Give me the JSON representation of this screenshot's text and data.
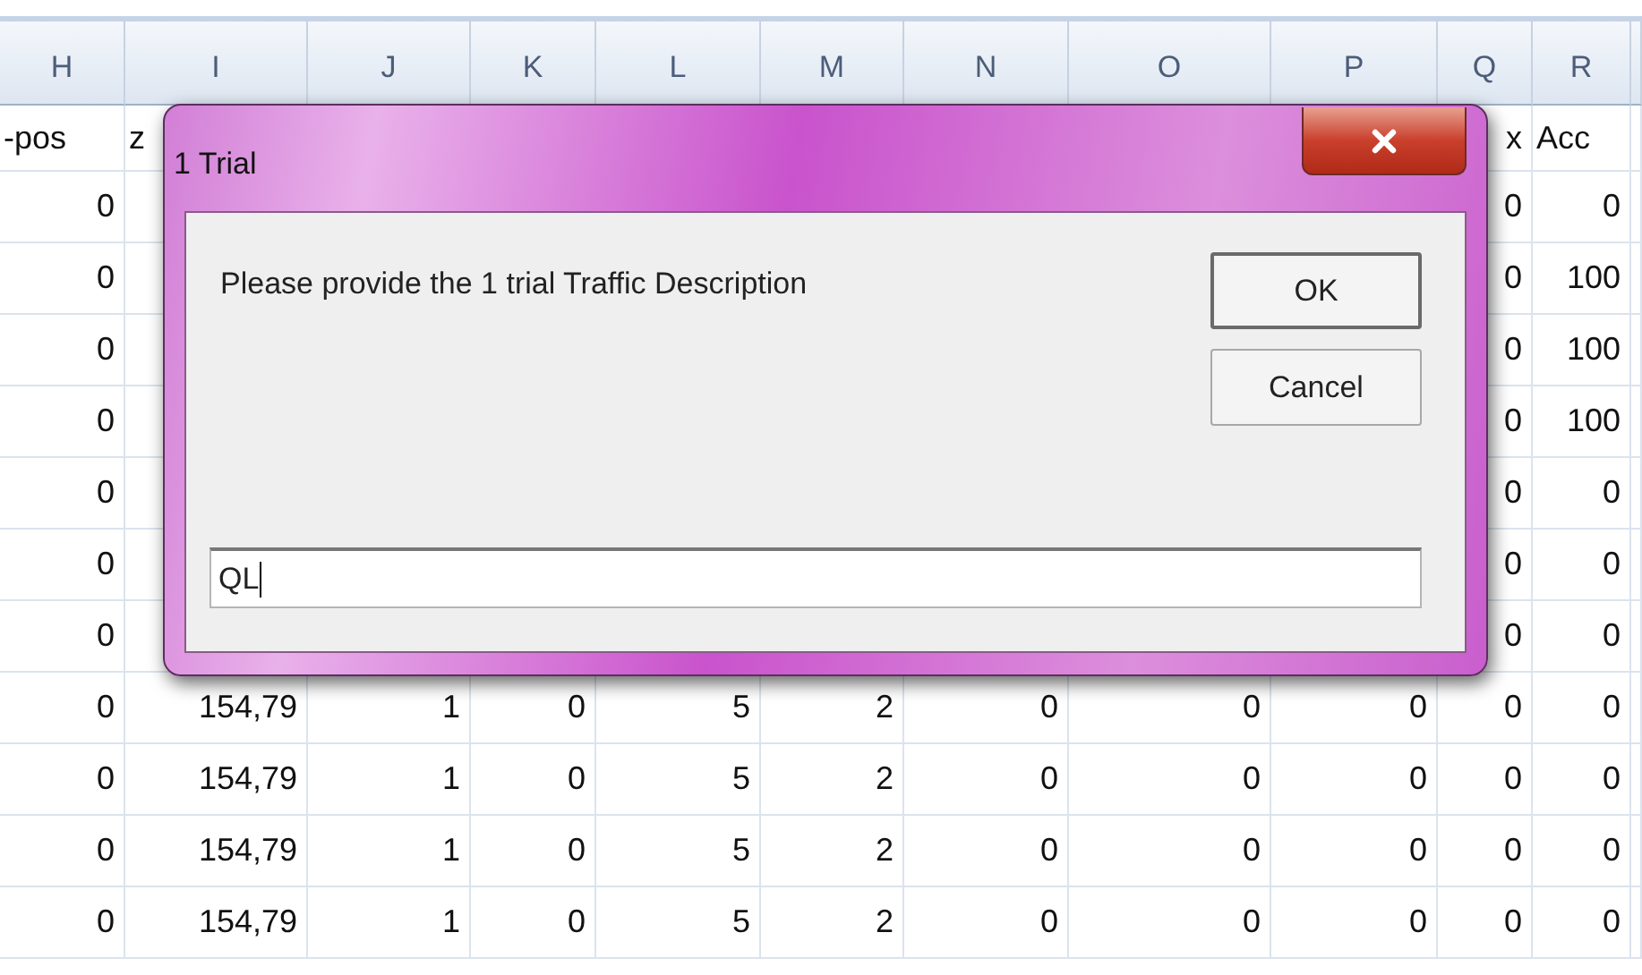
{
  "sheet": {
    "columns": [
      "H",
      "I",
      "J",
      "K",
      "L",
      "M",
      "N",
      "O",
      "P",
      "Q",
      "R"
    ],
    "rows": [
      {
        "cells": [
          "-pos",
          "z",
          null,
          null,
          null,
          null,
          null,
          null,
          null,
          "x",
          "Acc"
        ]
      },
      {
        "cells": [
          "0",
          null,
          null,
          null,
          null,
          null,
          null,
          null,
          null,
          "0",
          "0"
        ]
      },
      {
        "cells": [
          "0",
          null,
          null,
          null,
          null,
          null,
          null,
          null,
          null,
          "0",
          "100"
        ]
      },
      {
        "cells": [
          "0",
          null,
          null,
          null,
          null,
          null,
          null,
          null,
          null,
          "0",
          "100"
        ]
      },
      {
        "cells": [
          "0",
          null,
          null,
          null,
          null,
          null,
          null,
          null,
          null,
          "0",
          "100"
        ]
      },
      {
        "cells": [
          "0",
          null,
          null,
          null,
          null,
          null,
          null,
          null,
          null,
          "0",
          "0"
        ]
      },
      {
        "cells": [
          "0",
          null,
          null,
          null,
          null,
          null,
          null,
          null,
          null,
          "0",
          "0"
        ]
      },
      {
        "cells": [
          "0",
          null,
          null,
          null,
          null,
          null,
          null,
          null,
          null,
          "0",
          "0"
        ]
      },
      {
        "cells": [
          "0",
          "154,79",
          "1",
          "0",
          "5",
          "2",
          "0",
          "0",
          "0",
          "0",
          "0"
        ]
      },
      {
        "cells": [
          "0",
          "154,79",
          "1",
          "0",
          "5",
          "2",
          "0",
          "0",
          "0",
          "0",
          "0"
        ]
      },
      {
        "cells": [
          "0",
          "154,79",
          "1",
          "0",
          "5",
          "2",
          "0",
          "0",
          "0",
          "0",
          "0"
        ]
      },
      {
        "cells": [
          "0",
          "154,79",
          "1",
          "0",
          "5",
          "2",
          "0",
          "0",
          "0",
          "0",
          "0"
        ]
      }
    ]
  },
  "dialog": {
    "title": "1 Trial",
    "message": "Please provide the 1 trial Traffic Description",
    "buttons": [
      {
        "label": "OK",
        "default": true
      },
      {
        "label": "Cancel",
        "default": false
      }
    ],
    "input": {
      "value": "QL"
    }
  }
}
